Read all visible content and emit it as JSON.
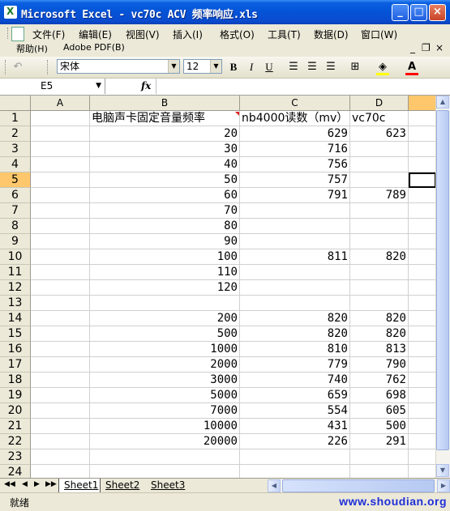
{
  "window": {
    "title": "Microsoft Excel - vc70c ACV 频率响应.xls",
    "minimize": "_",
    "maximize": "□",
    "close": "×"
  },
  "menu": {
    "items": [
      "文件(F)",
      "编辑(E)",
      "视图(V)",
      "插入(I)",
      "格式(O)",
      "工具(T)",
      "数据(D)",
      "窗口(W)"
    ],
    "row2": [
      "帮助(H)",
      "Adobe PDF(B)"
    ],
    "mdi": {
      "minimize": "_",
      "restore": "❐",
      "close": "×"
    }
  },
  "toolbar": {
    "font_name": "宋体",
    "font_size": "12",
    "bold": "B",
    "italic": "I",
    "underline": "U",
    "fill_color": "#ffff00",
    "font_color": "#ff0000"
  },
  "formula_bar": {
    "name_box": "E5",
    "fx": "fx",
    "content": ""
  },
  "columns": [
    "A",
    "B",
    "C",
    "D"
  ],
  "rows": [
    {
      "n": "1",
      "B": "电脑声卡固定音量频率",
      "C": "nb4000读数（mv）",
      "D": "vc70c"
    },
    {
      "n": "2",
      "B": "20",
      "C": "629",
      "D": "623"
    },
    {
      "n": "3",
      "B": "30",
      "C": "716",
      "D": ""
    },
    {
      "n": "4",
      "B": "40",
      "C": "756",
      "D": ""
    },
    {
      "n": "5",
      "B": "50",
      "C": "757",
      "D": ""
    },
    {
      "n": "6",
      "B": "60",
      "C": "791",
      "D": "789"
    },
    {
      "n": "7",
      "B": "70",
      "C": "",
      "D": ""
    },
    {
      "n": "8",
      "B": "80",
      "C": "",
      "D": ""
    },
    {
      "n": "9",
      "B": "90",
      "C": "",
      "D": ""
    },
    {
      "n": "10",
      "B": "100",
      "C": "811",
      "D": "820"
    },
    {
      "n": "11",
      "B": "110",
      "C": "",
      "D": ""
    },
    {
      "n": "12",
      "B": "120",
      "C": "",
      "D": ""
    },
    {
      "n": "13",
      "B": "",
      "C": "",
      "D": ""
    },
    {
      "n": "14",
      "B": "200",
      "C": "820",
      "D": "820"
    },
    {
      "n": "15",
      "B": "500",
      "C": "820",
      "D": "820"
    },
    {
      "n": "16",
      "B": "1000",
      "C": "810",
      "D": "813"
    },
    {
      "n": "17",
      "B": "2000",
      "C": "779",
      "D": "790"
    },
    {
      "n": "18",
      "B": "3000",
      "C": "740",
      "D": "762"
    },
    {
      "n": "19",
      "B": "5000",
      "C": "659",
      "D": "698"
    },
    {
      "n": "20",
      "B": "7000",
      "C": "554",
      "D": "605"
    },
    {
      "n": "21",
      "B": "10000",
      "C": "431",
      "D": "500"
    },
    {
      "n": "22",
      "B": "20000",
      "C": "226",
      "D": "291"
    },
    {
      "n": "23",
      "B": "",
      "C": "",
      "D": ""
    },
    {
      "n": "24",
      "B": "",
      "C": "",
      "D": ""
    }
  ],
  "selected_cell": "E5",
  "tabs": {
    "nav": [
      "◀◀",
      "◀",
      "▶",
      "▶▶"
    ],
    "sheets": [
      "Sheet1",
      "Sheet2",
      "Sheet3"
    ],
    "active": "Sheet1"
  },
  "status": {
    "text": "就绪",
    "watermark": "www.shoudian.org"
  }
}
